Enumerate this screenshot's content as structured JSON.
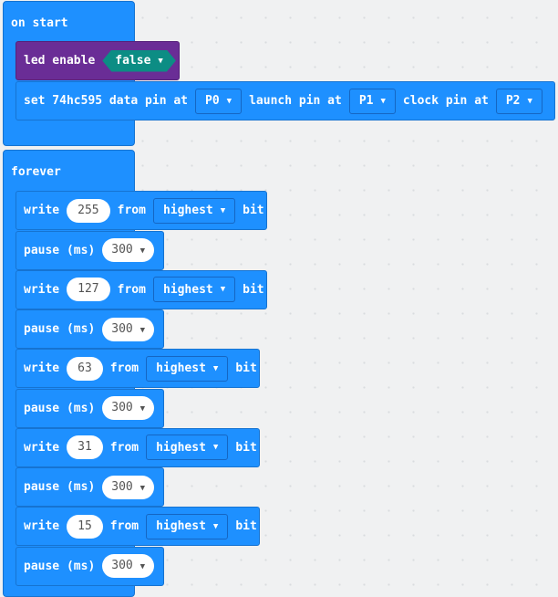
{
  "on_start": {
    "label": "on start",
    "led_block": {
      "label": "led enable",
      "value": "false"
    },
    "set_block": {
      "label_set": "set 74hc595 data pin at",
      "data_pin": "P0",
      "label_launch": "launch pin at",
      "launch_pin": "P1",
      "label_clock": "clock pin at",
      "clock_pin": "P2"
    }
  },
  "forever": {
    "label": "forever",
    "write_label": "write",
    "from_label": "from",
    "bit_label": "bit",
    "pause_label": "pause (ms)",
    "steps": [
      {
        "write_value": "255",
        "order": "highest",
        "pause_value": "300"
      },
      {
        "write_value": "127",
        "order": "highest",
        "pause_value": "300"
      },
      {
        "write_value": "63",
        "order": "highest",
        "pause_value": "300"
      },
      {
        "write_value": "31",
        "order": "highest",
        "pause_value": "300"
      },
      {
        "write_value": "15",
        "order": "highest",
        "pause_value": "300"
      }
    ]
  },
  "colors": {
    "block_blue": "#1e90ff",
    "block_purple": "#6a2d96",
    "boolean_teal": "#0c8d84",
    "workspace": "#f0f1f2"
  }
}
